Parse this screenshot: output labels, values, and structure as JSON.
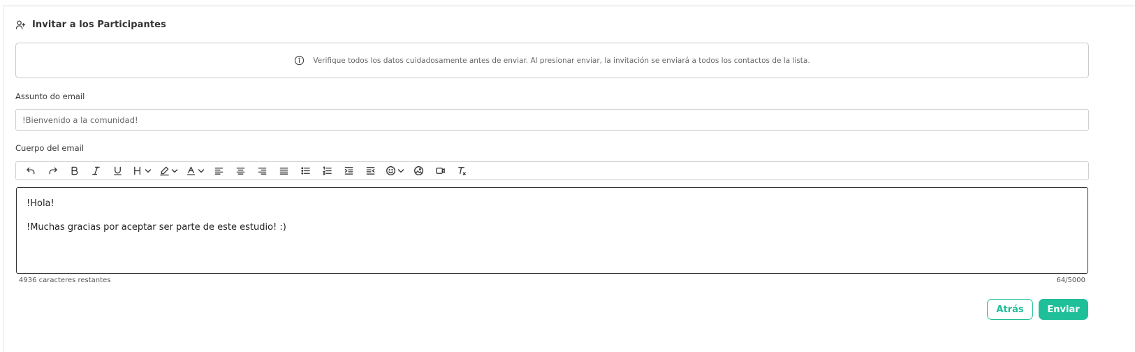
{
  "header": {
    "title": "Invitar a los Participantes",
    "icon": "user-plus-icon"
  },
  "info": {
    "icon": "info-icon",
    "text": "Verifique todos los datos cuidadosamente antes de enviar. Al presionar enviar, la invitación se enviará a todos los contactos de la lista."
  },
  "subject": {
    "label": "Assunto do email",
    "value": "!Bienvenido a la comunidad!"
  },
  "body": {
    "label": "Cuerpo del email",
    "toolbar": [
      "undo-icon",
      "redo-icon",
      "bold-icon",
      "italic-icon",
      "underline-icon",
      "heading-icon",
      "highlight-icon",
      "font-color-icon",
      "align-left-icon",
      "align-center-icon",
      "align-right-icon",
      "align-justify-icon",
      "bullet-list-icon",
      "numbered-list-icon",
      "indent-icon",
      "outdent-icon",
      "emoji-icon",
      "image-icon",
      "video-icon",
      "clear-format-icon"
    ],
    "paragraphs": [
      "!Hola!",
      "!Muchas gracias por aceptar ser parte de este estudio! :)"
    ],
    "remaining": "4936 caracteres restantes",
    "count": "64/5000"
  },
  "actions": {
    "back_label": "Atrás",
    "send_label": "Enviar"
  },
  "colors": {
    "accent": "#1fbf99",
    "border": "#cfcfcf"
  }
}
